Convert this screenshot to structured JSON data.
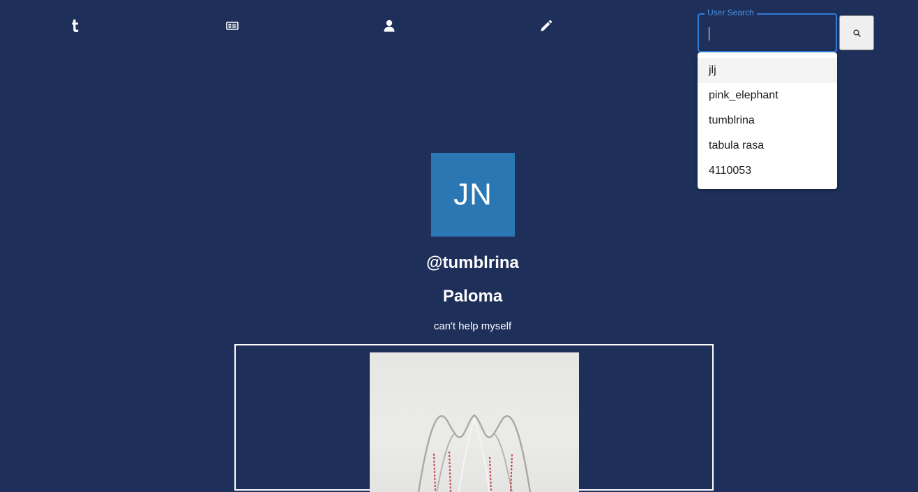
{
  "nav": {
    "items": [
      {
        "icon": "tumblr-logo-icon"
      },
      {
        "icon": "newspaper-icon"
      },
      {
        "icon": "user-icon"
      },
      {
        "icon": "pencil-icon"
      }
    ]
  },
  "search": {
    "label": "User Search",
    "value": "",
    "button_icon": "search-icon",
    "suggestions": [
      "jlj",
      "pink_elephant",
      "tumblrina",
      "tabula rasa",
      "4110053"
    ]
  },
  "profile": {
    "avatar_initials": "JN",
    "avatar_color": "#2a77b4",
    "username": "@tumblrina",
    "display_name": "Paloma",
    "bio": "can't help myself"
  },
  "theme": {
    "background": "#1e2f5a",
    "accent": "#2f7bd8"
  }
}
